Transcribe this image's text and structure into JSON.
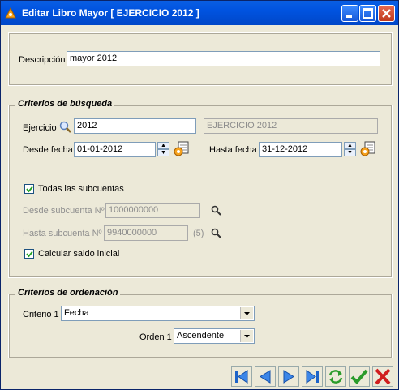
{
  "window": {
    "title": "Editar Libro Mayor [ EJERCICIO 2012 ]"
  },
  "descripcion": {
    "label": "Descripción",
    "value": "mayor 2012"
  },
  "criterios_busqueda": {
    "legend": "Criterios de búsqueda",
    "ejercicio_label": "Ejercicio",
    "ejercicio_value": "2012",
    "ejercicio_desc": "EJERCICIO 2012",
    "desde_fecha_label": "Desde fecha",
    "desde_fecha_value": "01-01-2012",
    "hasta_fecha_label": "Hasta fecha",
    "hasta_fecha_value": "31-12-2012",
    "todas_label": "Todas las subcuentas",
    "todas_checked": true,
    "desde_sub_label": "Desde subcuenta Nº",
    "desde_sub_value": "1000000000",
    "hasta_sub_label": "Hasta subcuenta Nº",
    "hasta_sub_value": "9940000000",
    "hasta_sub_hint": "(5)",
    "saldo_label": "Calcular saldo inicial",
    "saldo_checked": true
  },
  "criterios_ordenacion": {
    "legend": "Criterios de ordenación",
    "criterio1_label": "Criterio 1",
    "criterio1_value": "Fecha",
    "orden1_label": "Orden 1",
    "orden1_value": "Ascendente"
  },
  "toolbar": {
    "buttons": [
      "first-icon",
      "previous-icon",
      "next-icon",
      "last-icon",
      "refresh-icon",
      "accept-icon",
      "cancel-icon"
    ]
  },
  "colors": {
    "titlebar": "#0053e0",
    "window_bg": "#ece9d8",
    "legend_text": "#000000",
    "accept": "#2b9b2b",
    "cancel": "#d01e1e"
  }
}
